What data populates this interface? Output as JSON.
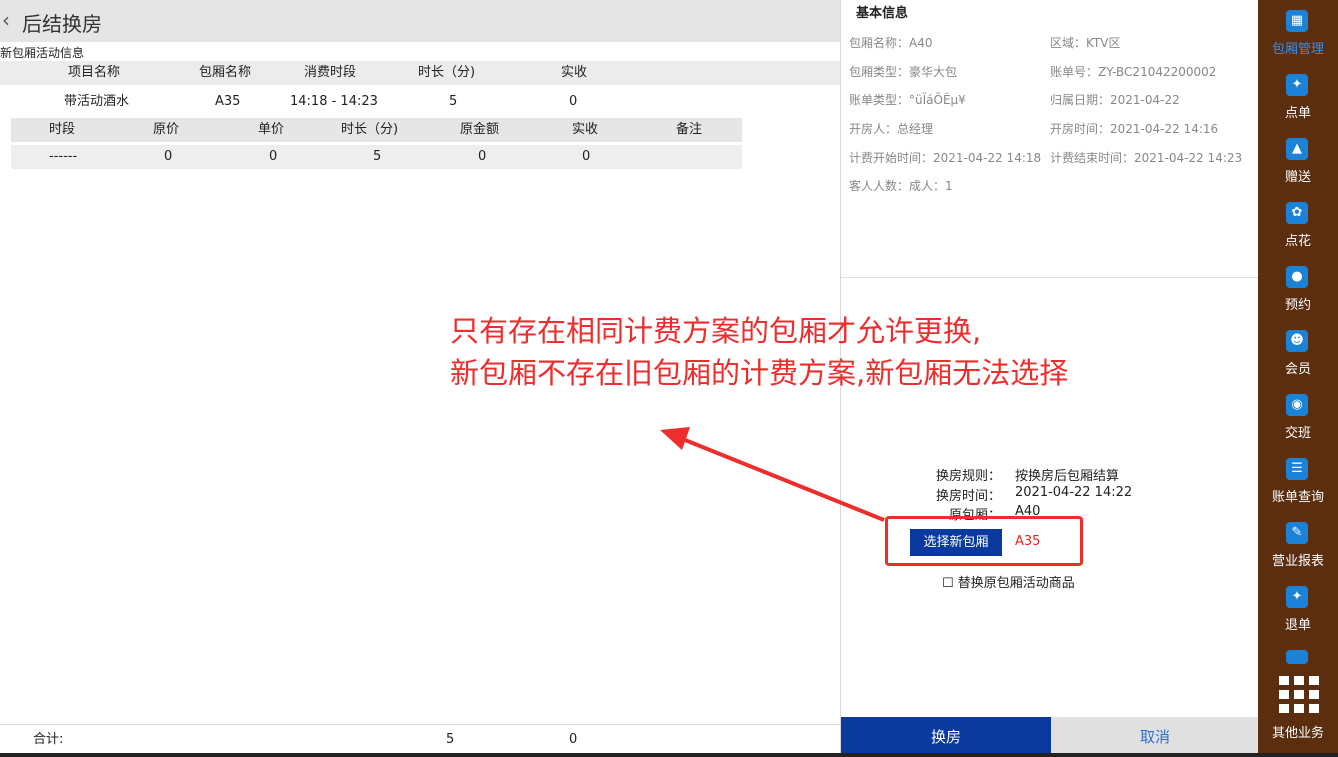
{
  "header": {
    "back_icon": "chevron-left-icon",
    "title": "后结换房"
  },
  "section_title": "新包厢活动信息",
  "main_table": {
    "headers": [
      "项目名称",
      "包厢名称",
      "消费时段",
      "时长（分)",
      "实收"
    ],
    "row": [
      "带活动酒水",
      "A35",
      "14:18 - 14:23",
      "5",
      "0"
    ]
  },
  "sub_table": {
    "headers": [
      "时段",
      "原价",
      "单价",
      "时长（分)",
      "原金额",
      "实收",
      "备注"
    ],
    "row": [
      "------",
      "0",
      "0",
      "5",
      "0",
      "0",
      ""
    ]
  },
  "footer": {
    "label": "合计:",
    "duration": "5",
    "amount": "0"
  },
  "info": {
    "title": "基本信息",
    "room_name": "包厢名称：A40",
    "area": "区域：KTV区",
    "room_type": "包厢类型：豪华大包",
    "bill_no": "账单号：ZY-BC21042200002",
    "bill_type": "账单类型：°üÏáÕÊµ¥",
    "belong_date": "归属日期：2021-04-22",
    "opener": "开房人：总经理",
    "open_time": "开房时间：2021-04-22 14:16",
    "charge_start": "计费开始时间：2021-04-22 14:18",
    "charge_end": "计费结束时间：2021-04-22 14:23",
    "guests": "客人人数：成人：1"
  },
  "change": {
    "rule_label": "换房规则：",
    "rule_value": "按换房后包厢结算",
    "time_label": "换房时间：",
    "time_value": "2021-04-22 14:22",
    "orig_label": "原包厢：",
    "orig_value": "A40",
    "select_button": "选择新包厢",
    "selected_room": "A35",
    "replace_checkbox": "☐ 替换原包厢活动商品",
    "confirm_button": "换房",
    "cancel_button": "取消"
  },
  "sidebar": {
    "items": [
      {
        "label": "包厢管理",
        "icon": "grid-small-icon",
        "active": true
      },
      {
        "label": "点单",
        "icon": "order-icon"
      },
      {
        "label": "赠送",
        "icon": "gift-icon"
      },
      {
        "label": "点花",
        "icon": "flower-icon"
      },
      {
        "label": "预约",
        "icon": "reserve-icon"
      },
      {
        "label": "会员",
        "icon": "member-icon"
      },
      {
        "label": "交班",
        "icon": "handover-icon"
      },
      {
        "label": "账单查询",
        "icon": "bill-search-icon"
      },
      {
        "label": "营业报表",
        "icon": "report-icon"
      },
      {
        "label": "退单",
        "icon": "refund-icon"
      }
    ],
    "other_label": "其他业务"
  },
  "annotation": {
    "line1": "只有存在相同计费方案的包厢才允许更换,",
    "line2": "新包厢不存在旧包厢的计费方案,新包厢无法选择"
  },
  "colors": {
    "accent": "#0a3a9e",
    "highlight": "#ee2d2d",
    "sidebar_bg": "#5a2e0e",
    "sidebar_icon": "#1a83d8",
    "active_label": "#3d8be8"
  }
}
